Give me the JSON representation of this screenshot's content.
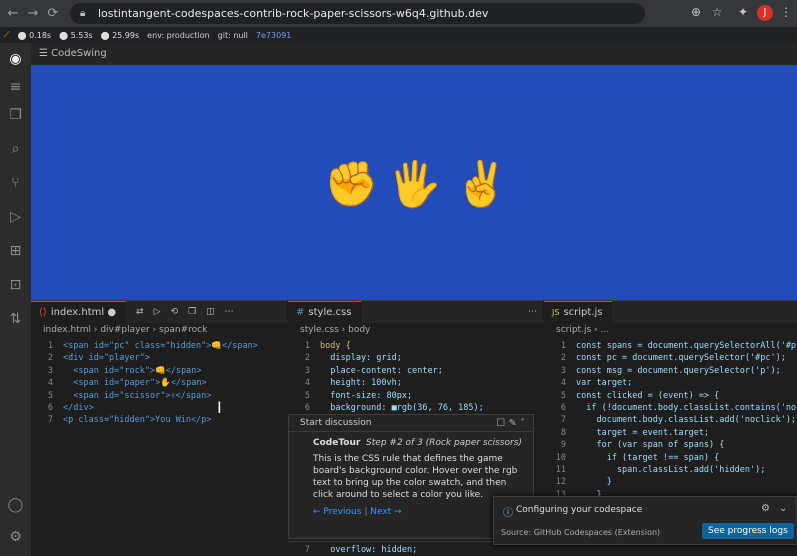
{
  "browser": {
    "url": "lostintangent-codespaces-contrib-rock-paper-scissors-w6q4.github.dev",
    "avatar_letter": "J"
  },
  "bookmarks": {
    "metric1": "0.18s",
    "metric2": "5.53s",
    "metric3": "25.99s",
    "env": "env: production",
    "git": "git: null",
    "hash": "7e73091"
  },
  "panel_title": "CodeSwing",
  "preview": {
    "background": "#244cb9",
    "emojis": [
      "✊",
      "🖐️",
      "✌️"
    ]
  },
  "html_editor": {
    "tab": "index.html",
    "crumbs": [
      "index.html",
      "div#player",
      "span#rock"
    ],
    "lines": [
      {
        "n": "1",
        "code": "<span id=\"pc\" class=\"hidden\">👊</span>"
      },
      {
        "n": "2",
        "code": "<div id=\"player\">"
      },
      {
        "n": "3",
        "code": "  <span id=\"rock\">👊</span>"
      },
      {
        "n": "4",
        "code": "  <span id=\"paper\">✋</span>"
      },
      {
        "n": "5",
        "code": "  <span id=\"scissor\">✌</span>"
      },
      {
        "n": "6",
        "code": "</div>"
      },
      {
        "n": "7",
        "code": "<p class=\"hidden\">You Win</p>"
      }
    ]
  },
  "css_editor": {
    "tab": "style.css",
    "crumbs": [
      "style.css",
      "body"
    ],
    "lines": [
      {
        "n": "1",
        "code": "body {"
      },
      {
        "n": "2",
        "code": "  display: grid;"
      },
      {
        "n": "3",
        "code": "  place-content: center;"
      },
      {
        "n": "4",
        "code": "  height: 100vh;"
      },
      {
        "n": "5",
        "code": "  font-size: 80px;"
      },
      {
        "n": "6",
        "code": "  background: ■rgb(36, 76, 185);"
      }
    ],
    "line7": {
      "n": "7",
      "code": "  overflow: hidden;"
    }
  },
  "js_editor": {
    "tab": "script.js",
    "crumbs": [
      "script.js",
      "..."
    ],
    "lines": [
      {
        "n": "1",
        "code": "const spans = document.querySelectorAll('#pl"
      },
      {
        "n": "2",
        "code": "const pc = document.querySelector('#pc');"
      },
      {
        "n": "3",
        "code": "const msg = document.querySelector('p');"
      },
      {
        "n": "4",
        "code": "var target;"
      },
      {
        "n": "5",
        "code": "const clicked = (event) => {"
      },
      {
        "n": "6",
        "code": "  if (!document.body.classList.contains('noc"
      },
      {
        "n": "7",
        "code": "    document.body.classList.add('noclick');"
      },
      {
        "n": "8",
        "code": "    target = event.target;"
      },
      {
        "n": "9",
        "code": "    for (var span of spans) {"
      },
      {
        "n": "10",
        "code": "      if (target !== span) {"
      },
      {
        "n": "11",
        "code": "        span.classList.add('hidden');"
      },
      {
        "n": "12",
        "code": "      }"
      },
      {
        "n": "13",
        "code": "    }"
      }
    ]
  },
  "discussion": {
    "header": "Start discussion",
    "title": "CodeTour",
    "step": "Step #2 of 3 (Rock paper scissors)",
    "body": "This is the CSS rule that defines the game board's background color. Hover over the rgb text to bring up the color swatch, and then click around to select a color you like.",
    "prev": "← Previous",
    "next": "Next →"
  },
  "notification": {
    "title": "Configuring your codespace",
    "source": "Source: GitHub Codespaces (Extension)",
    "button": "See progress logs"
  }
}
